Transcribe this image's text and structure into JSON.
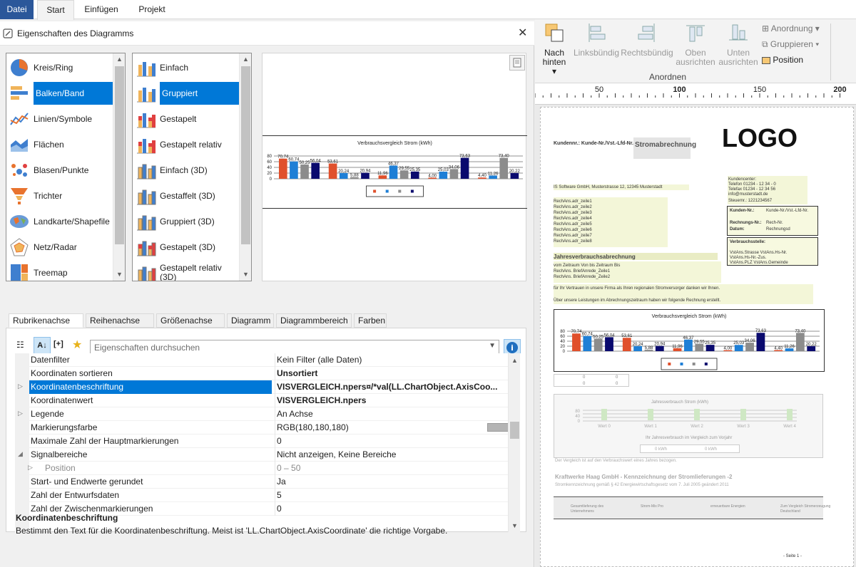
{
  "menu": {
    "datei": "Datei",
    "start": "Start",
    "einfuegen": "Einfügen",
    "projekt": "Projekt"
  },
  "dialog": {
    "title": "Eigenschaften des Diagramms",
    "chart_types": [
      {
        "label": "Kreis/Ring",
        "icon": "pie-chart-icon"
      },
      {
        "label": "Balken/Band",
        "icon": "bar-chart-icon"
      },
      {
        "label": "Linien/Symbole",
        "icon": "line-chart-icon"
      },
      {
        "label": "Flächen",
        "icon": "area-chart-icon"
      },
      {
        "label": "Blasen/Punkte",
        "icon": "bubble-chart-icon"
      },
      {
        "label": "Trichter",
        "icon": "funnel-chart-icon"
      },
      {
        "label": "Landkarte/Shapefile",
        "icon": "map-chart-icon"
      },
      {
        "label": "Netz/Radar",
        "icon": "radar-chart-icon"
      },
      {
        "label": "Treemap",
        "icon": "treemap-chart-icon"
      }
    ],
    "selected_type_index": 1,
    "subtypes": [
      {
        "label": "Einfach"
      },
      {
        "label": "Gruppiert"
      },
      {
        "label": "Gestapelt"
      },
      {
        "label": "Gestapelt relativ"
      },
      {
        "label": "Einfach (3D)"
      },
      {
        "label": "Gestaffelt (3D)"
      },
      {
        "label": "Gruppiert (3D)"
      },
      {
        "label": "Gestapelt (3D)"
      },
      {
        "label": "Gestapelt relativ (3D)"
      }
    ],
    "selected_subtype_index": 1,
    "tabs": [
      "Rubrikenachse (x)",
      "Reihenachse (y)",
      "Größenachse (z)",
      "Diagramm",
      "Diagrammbereich",
      "Farben"
    ],
    "search_placeholder": "Eigenschaften durchsuchen",
    "properties": [
      {
        "name": "Datenfilter",
        "value": "Kein Filter (alle Daten)",
        "bold": false,
        "expand": false,
        "indent": false,
        "gray": false
      },
      {
        "name": "Koordinaten sortieren",
        "value": "Unsortiert",
        "bold": true,
        "expand": false,
        "indent": false,
        "gray": false
      },
      {
        "name": "Koordinatenbeschriftung",
        "value": "VISVERGLEICH.npers¤/*val(LL.ChartObject.AxisCoo...",
        "bold": true,
        "expand": true,
        "indent": false,
        "gray": false,
        "selected": true
      },
      {
        "name": "Koordinatenwert",
        "value": "VISVERGLEICH.npers",
        "bold": true,
        "expand": false,
        "indent": false,
        "gray": false
      },
      {
        "name": "Legende",
        "value": "An Achse",
        "bold": false,
        "expand": true,
        "indent": false,
        "gray": false
      },
      {
        "name": "Markierungsfarbe",
        "value": "RGB(180,180,180)",
        "bold": false,
        "expand": false,
        "indent": false,
        "gray": false,
        "swatch": "#b4b4b4"
      },
      {
        "name": "Maximale Zahl der Hauptmarkierungen",
        "value": "0",
        "bold": false,
        "expand": false,
        "indent": false,
        "gray": false
      },
      {
        "name": "Signalbereiche",
        "value": "Nicht anzeigen, Keine Bereiche",
        "bold": false,
        "expand": "open",
        "indent": false,
        "gray": false
      },
      {
        "name": "Position",
        "value": "0 – 50",
        "bold": false,
        "expand": true,
        "indent": true,
        "gray": true
      },
      {
        "name": "Start- und Endwerte gerundet",
        "value": "Ja",
        "bold": false,
        "expand": false,
        "indent": false,
        "gray": false
      },
      {
        "name": "Zahl der Entwurfsdaten",
        "value": "5",
        "bold": false,
        "expand": false,
        "indent": false,
        "gray": false
      },
      {
        "name": "Zahl der Zwischenmarkierungen",
        "value": "0",
        "bold": false,
        "expand": false,
        "indent": false,
        "gray": false
      }
    ],
    "desc_title": "Koordinatenbeschriftung",
    "desc_text": "Bestimmt den Text für die Koordinatenbeschriftung. Meist ist 'LL.ChartObject.AxisCoordinate' die richtige Vorgabe."
  },
  "ribbon": {
    "nach_hinten": "Nach",
    "nach_hinten2": "hinten",
    "linksbuendig": "Linksbündig",
    "rechtsbuendig": "Rechtsbündig",
    "oben1": "Oben",
    "oben2": "ausrichten",
    "unten1": "Unten",
    "unten2": "ausrichten",
    "anordnung": "Anordnung",
    "gruppieren": "Gruppieren",
    "position": "Position",
    "group_label": "Anordnen"
  },
  "ruler": {
    "labels": [
      "50",
      "100",
      "150",
      "200"
    ]
  },
  "chart_data": {
    "type": "bar",
    "title": "Verbrauchsvergleich Strom (kWh)",
    "ylim": [
      0,
      80
    ],
    "yticks": [
      "80",
      "60",
      "40",
      "20",
      "0"
    ],
    "series_colors": [
      "#e0502c",
      "#1e7fd6",
      "#8c8c8c",
      "#0a0a6e"
    ],
    "groups": [
      [
        70.74,
        60.74,
        50.25,
        56.04
      ],
      [
        53.61,
        20.24,
        5.88,
        20.94
      ],
      [
        11.96,
        46.37,
        29.55,
        25.35
      ],
      [
        4.0,
        25.03,
        34.06,
        73.63
      ],
      [
        4.4,
        11.26,
        73.4,
        20.22
      ]
    ],
    "labels": [
      "70,74",
      "60,74",
      "50,25",
      "56,04",
      "53,61",
      "20,24",
      "5,88",
      "20,94",
      "11,96",
      "46,37",
      "29,55",
      "25,35",
      "4,00",
      "25,03",
      "34,06",
      "73,63",
      "4,40",
      "11,26",
      "73,40",
      "20,22"
    ]
  },
  "report": {
    "logo": "LOGO",
    "kunde": "Kundennr.: Kunde-Nr./Vst.-Lfd-Nr.",
    "bezeichnung": "Stromabrechnung",
    "sender": "IS Software GmbH, Musterstrasse 12, 12345 Musterstadt",
    "address_lines": [
      "RechAns.adr_zeile1",
      "RechAns.adr_zeile2",
      "RechAns.adr_zeile3",
      "RechAns.adr_zeile4",
      "RechAns.adr_zeile5",
      "RechAns.adr_zeile6",
      "RechAns.adr_zeile7",
      "RechAns.adr_zeile8"
    ],
    "kundencenter": [
      "Kundencenter:",
      "Telefon 01234 - 12 34 - 0",
      "Telefax 01234 - 12 34 56",
      "info@musterstadt.de"
    ],
    "steuer": "Steuernr.: 1221234567",
    "kunde_nr_label": "Kunden-Nr.:",
    "kunde_nr_val": "Kunde-Nr./Vst.-Lfd-Nr.",
    "rechnung_label": "Rechnungs-Nr.:",
    "rechnung_val": "Rech-Nr.",
    "datum_label": "Datum:",
    "datum_val": "Rechnungsd",
    "verbrauch_label": "Verbrauchsstelle:",
    "verbrauch_lines": [
      "VstAns.Strasse VstAns.Hs-Nr.",
      "VstAns.Hs-Nr.-Zus.",
      "VstAns.PLZ VstAns.Gemeinde"
    ],
    "heading": "Jahresverbrauchsabrechnung",
    "lines": [
      "vom Zeitraum  Von bis Zeitraum  Bis",
      "RechAns. BriefAnrede_Zeile1",
      "RechAns. BriefAnrede_Zeile2"
    ],
    "thanks": "für Ihr Vertrauen in unsere Firma als Ihren regionalen Stromversorger danken wir Ihnen.",
    "leistung": "Über unsere Leistungen im Abrechnungszeitraum haben wir folgende Rechnung erstellt.",
    "chart2_title": "Jahresverbrauch Strom (kWh)",
    "chart2_cats": [
      "Wert 0",
      "Wert 1",
      "Wert 2",
      "Wert 3",
      "Wert 4"
    ],
    "chart2_sub": "Ihr Jahresverbrauch im Vergleich zum Vorjahr",
    "vergleich": "Der Vergleich ist auf den Verbrauchswert eines Jahres bezogen.",
    "kraftwerk": "Kraftwerke Haag GmbH -  Kennzeichnung der Stromlieferungen -2",
    "kennz": "Stromkennzeichnung gemäß § 42 Energiewirtschaftsgesetz vom 7. Juli 2005 geändert 2011",
    "footer_cols": [
      "Gesamtlieferung des Unternehmens",
      "Strom-Mix Pro",
      "erneuerbare Energien",
      "Zum Vergleich Stromerzeugung Deutschland"
    ],
    "page": "- Seite 1 -"
  }
}
